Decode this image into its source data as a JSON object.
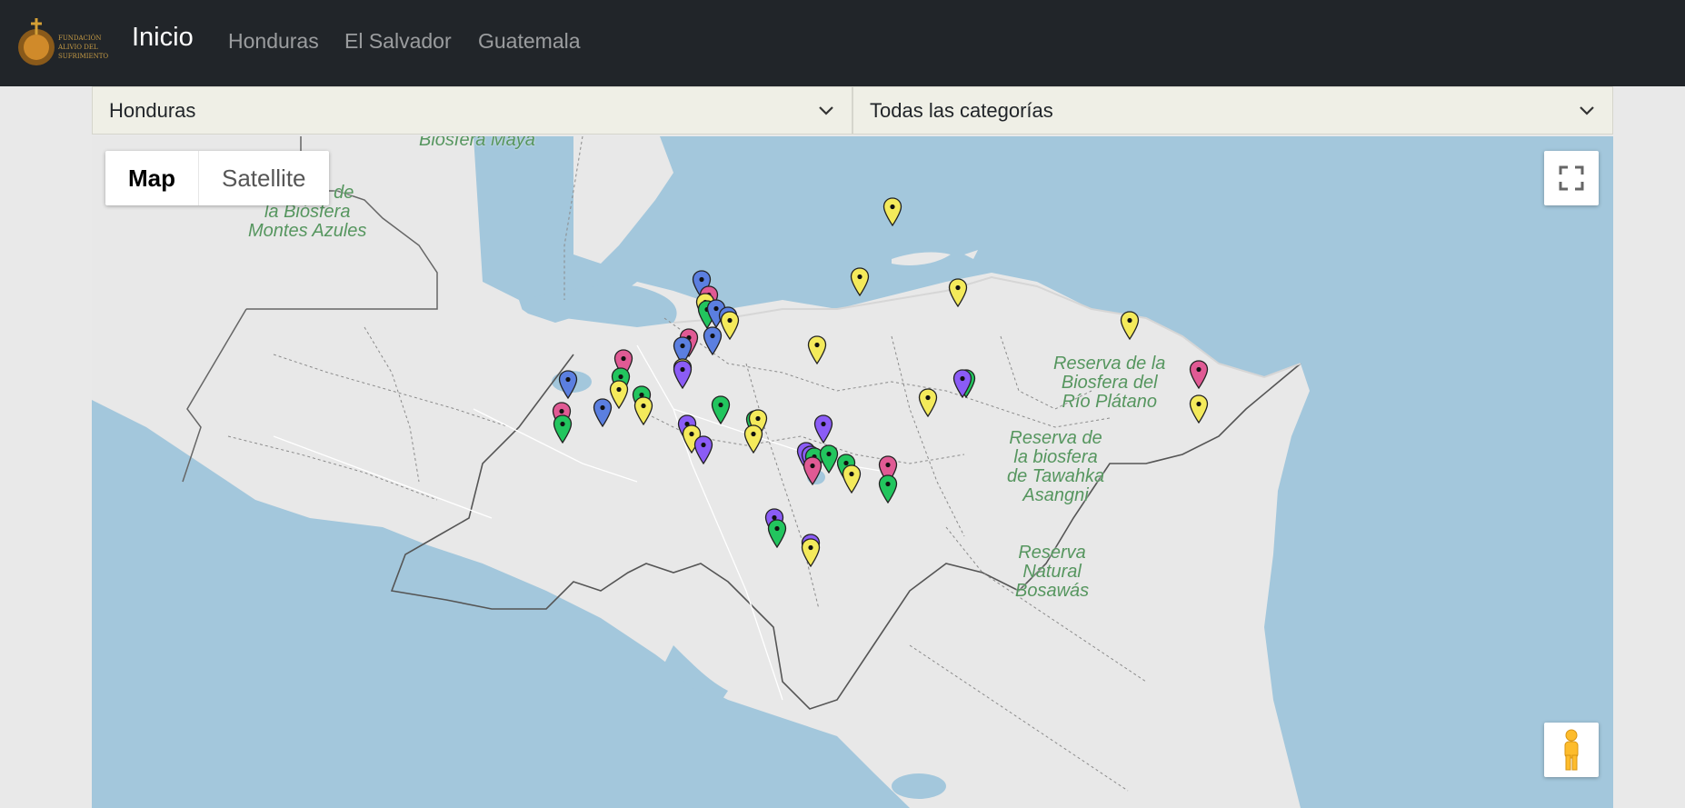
{
  "nav": {
    "brand": "Inicio",
    "links": [
      "Honduras",
      "El Salvador",
      "Guatemala"
    ],
    "logo_text": [
      "FUNDACIÓN",
      "ALIVIO DEL",
      "SUFRIMIENTO"
    ]
  },
  "filters": {
    "country": {
      "selected": "Honduras"
    },
    "category": {
      "selected": "Todas las categorías"
    }
  },
  "map": {
    "type_buttons": [
      "Map",
      "Satellite"
    ],
    "active_type": "Map",
    "labels": [
      "Biosfera Maya",
      "Reserva de\nla Biósfera\nMontes Azules",
      "Reserva de la\nBiosfera del\nRío Plátano",
      "Reserva de\nla biosfera\nde Tawahka\nAsangni",
      "Reserva\nNatural\nBosawás"
    ],
    "colors": {
      "water": "#a3c7dc",
      "land": "#e8e8e8",
      "marker_yellow": "#f4ea5b",
      "marker_pink": "#e05a94",
      "marker_blue": "#5b7fe0",
      "marker_green": "#22c55e",
      "marker_purple": "#8b5cf6"
    }
  }
}
